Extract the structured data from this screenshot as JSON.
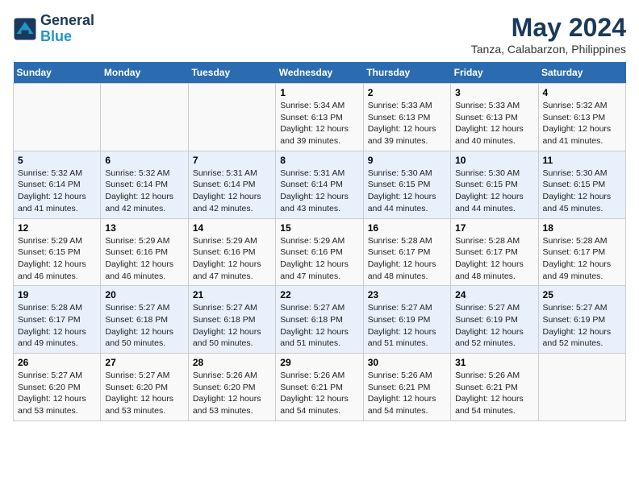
{
  "header": {
    "logo_line1": "General",
    "logo_line2": "Blue",
    "title": "May 2024",
    "subtitle": "Tanza, Calabarzon, Philippines"
  },
  "calendar": {
    "days_of_week": [
      "Sunday",
      "Monday",
      "Tuesday",
      "Wednesday",
      "Thursday",
      "Friday",
      "Saturday"
    ],
    "weeks": [
      [
        {
          "day": "",
          "info": ""
        },
        {
          "day": "",
          "info": ""
        },
        {
          "day": "",
          "info": ""
        },
        {
          "day": "1",
          "info": "Sunrise: 5:34 AM\nSunset: 6:13 PM\nDaylight: 12 hours\nand 39 minutes."
        },
        {
          "day": "2",
          "info": "Sunrise: 5:33 AM\nSunset: 6:13 PM\nDaylight: 12 hours\nand 39 minutes."
        },
        {
          "day": "3",
          "info": "Sunrise: 5:33 AM\nSunset: 6:13 PM\nDaylight: 12 hours\nand 40 minutes."
        },
        {
          "day": "4",
          "info": "Sunrise: 5:32 AM\nSunset: 6:13 PM\nDaylight: 12 hours\nand 41 minutes."
        }
      ],
      [
        {
          "day": "5",
          "info": "Sunrise: 5:32 AM\nSunset: 6:14 PM\nDaylight: 12 hours\nand 41 minutes."
        },
        {
          "day": "6",
          "info": "Sunrise: 5:32 AM\nSunset: 6:14 PM\nDaylight: 12 hours\nand 42 minutes."
        },
        {
          "day": "7",
          "info": "Sunrise: 5:31 AM\nSunset: 6:14 PM\nDaylight: 12 hours\nand 42 minutes."
        },
        {
          "day": "8",
          "info": "Sunrise: 5:31 AM\nSunset: 6:14 PM\nDaylight: 12 hours\nand 43 minutes."
        },
        {
          "day": "9",
          "info": "Sunrise: 5:30 AM\nSunset: 6:15 PM\nDaylight: 12 hours\nand 44 minutes."
        },
        {
          "day": "10",
          "info": "Sunrise: 5:30 AM\nSunset: 6:15 PM\nDaylight: 12 hours\nand 44 minutes."
        },
        {
          "day": "11",
          "info": "Sunrise: 5:30 AM\nSunset: 6:15 PM\nDaylight: 12 hours\nand 45 minutes."
        }
      ],
      [
        {
          "day": "12",
          "info": "Sunrise: 5:29 AM\nSunset: 6:15 PM\nDaylight: 12 hours\nand 46 minutes."
        },
        {
          "day": "13",
          "info": "Sunrise: 5:29 AM\nSunset: 6:16 PM\nDaylight: 12 hours\nand 46 minutes."
        },
        {
          "day": "14",
          "info": "Sunrise: 5:29 AM\nSunset: 6:16 PM\nDaylight: 12 hours\nand 47 minutes."
        },
        {
          "day": "15",
          "info": "Sunrise: 5:29 AM\nSunset: 6:16 PM\nDaylight: 12 hours\nand 47 minutes."
        },
        {
          "day": "16",
          "info": "Sunrise: 5:28 AM\nSunset: 6:17 PM\nDaylight: 12 hours\nand 48 minutes."
        },
        {
          "day": "17",
          "info": "Sunrise: 5:28 AM\nSunset: 6:17 PM\nDaylight: 12 hours\nand 48 minutes."
        },
        {
          "day": "18",
          "info": "Sunrise: 5:28 AM\nSunset: 6:17 PM\nDaylight: 12 hours\nand 49 minutes."
        }
      ],
      [
        {
          "day": "19",
          "info": "Sunrise: 5:28 AM\nSunset: 6:17 PM\nDaylight: 12 hours\nand 49 minutes."
        },
        {
          "day": "20",
          "info": "Sunrise: 5:27 AM\nSunset: 6:18 PM\nDaylight: 12 hours\nand 50 minutes."
        },
        {
          "day": "21",
          "info": "Sunrise: 5:27 AM\nSunset: 6:18 PM\nDaylight: 12 hours\nand 50 minutes."
        },
        {
          "day": "22",
          "info": "Sunrise: 5:27 AM\nSunset: 6:18 PM\nDaylight: 12 hours\nand 51 minutes."
        },
        {
          "day": "23",
          "info": "Sunrise: 5:27 AM\nSunset: 6:19 PM\nDaylight: 12 hours\nand 51 minutes."
        },
        {
          "day": "24",
          "info": "Sunrise: 5:27 AM\nSunset: 6:19 PM\nDaylight: 12 hours\nand 52 minutes."
        },
        {
          "day": "25",
          "info": "Sunrise: 5:27 AM\nSunset: 6:19 PM\nDaylight: 12 hours\nand 52 minutes."
        }
      ],
      [
        {
          "day": "26",
          "info": "Sunrise: 5:27 AM\nSunset: 6:20 PM\nDaylight: 12 hours\nand 53 minutes."
        },
        {
          "day": "27",
          "info": "Sunrise: 5:27 AM\nSunset: 6:20 PM\nDaylight: 12 hours\nand 53 minutes."
        },
        {
          "day": "28",
          "info": "Sunrise: 5:26 AM\nSunset: 6:20 PM\nDaylight: 12 hours\nand 53 minutes."
        },
        {
          "day": "29",
          "info": "Sunrise: 5:26 AM\nSunset: 6:21 PM\nDaylight: 12 hours\nand 54 minutes."
        },
        {
          "day": "30",
          "info": "Sunrise: 5:26 AM\nSunset: 6:21 PM\nDaylight: 12 hours\nand 54 minutes."
        },
        {
          "day": "31",
          "info": "Sunrise: 5:26 AM\nSunset: 6:21 PM\nDaylight: 12 hours\nand 54 minutes."
        },
        {
          "day": "",
          "info": ""
        }
      ]
    ]
  }
}
